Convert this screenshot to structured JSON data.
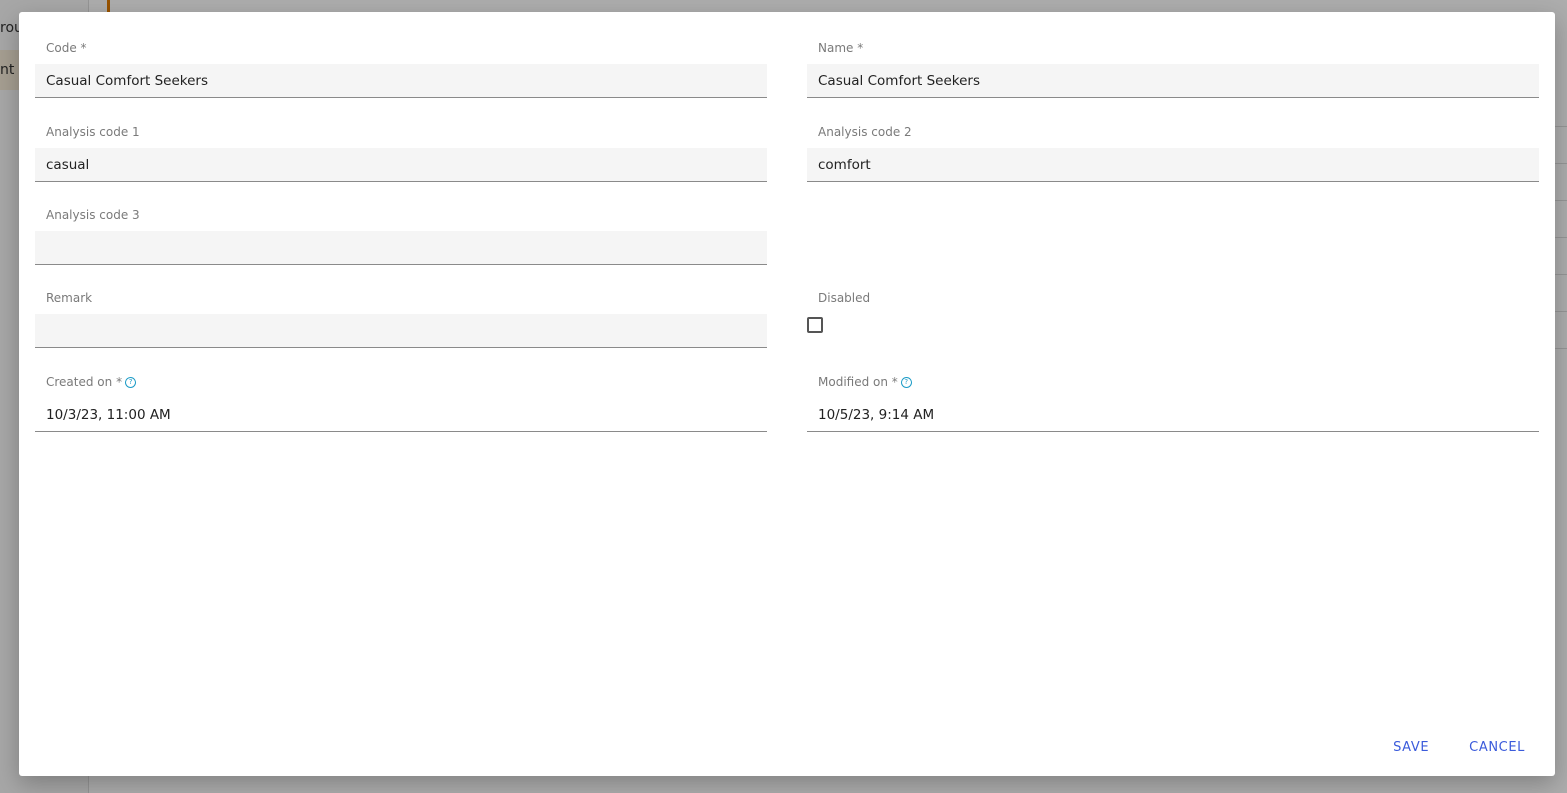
{
  "background": {
    "sidebar_partial_text_1": "rou",
    "sidebar_partial_text_2": "nt"
  },
  "form": {
    "code": {
      "label": "Code *",
      "value": "Casual Comfort Seekers"
    },
    "name": {
      "label": "Name *",
      "value": "Casual Comfort Seekers"
    },
    "analysis_code_1": {
      "label": "Analysis code 1",
      "value": "casual"
    },
    "analysis_code_2": {
      "label": "Analysis code 2",
      "value": "comfort"
    },
    "analysis_code_3": {
      "label": "Analysis code 3",
      "value": ""
    },
    "remark": {
      "label": "Remark",
      "value": ""
    },
    "disabled": {
      "label": "Disabled",
      "checked": false
    },
    "created_on": {
      "label": "Created on *",
      "value": "10/3/23, 11:00 AM"
    },
    "modified_on": {
      "label": "Modified on *",
      "value": "10/5/23, 9:14 AM"
    }
  },
  "actions": {
    "save_label": "SAVE",
    "cancel_label": "CANCEL"
  },
  "colors": {
    "accent": "#3b5bdb",
    "help_icon": "#1d9cc7"
  },
  "icons": {
    "help": "help-icon"
  }
}
